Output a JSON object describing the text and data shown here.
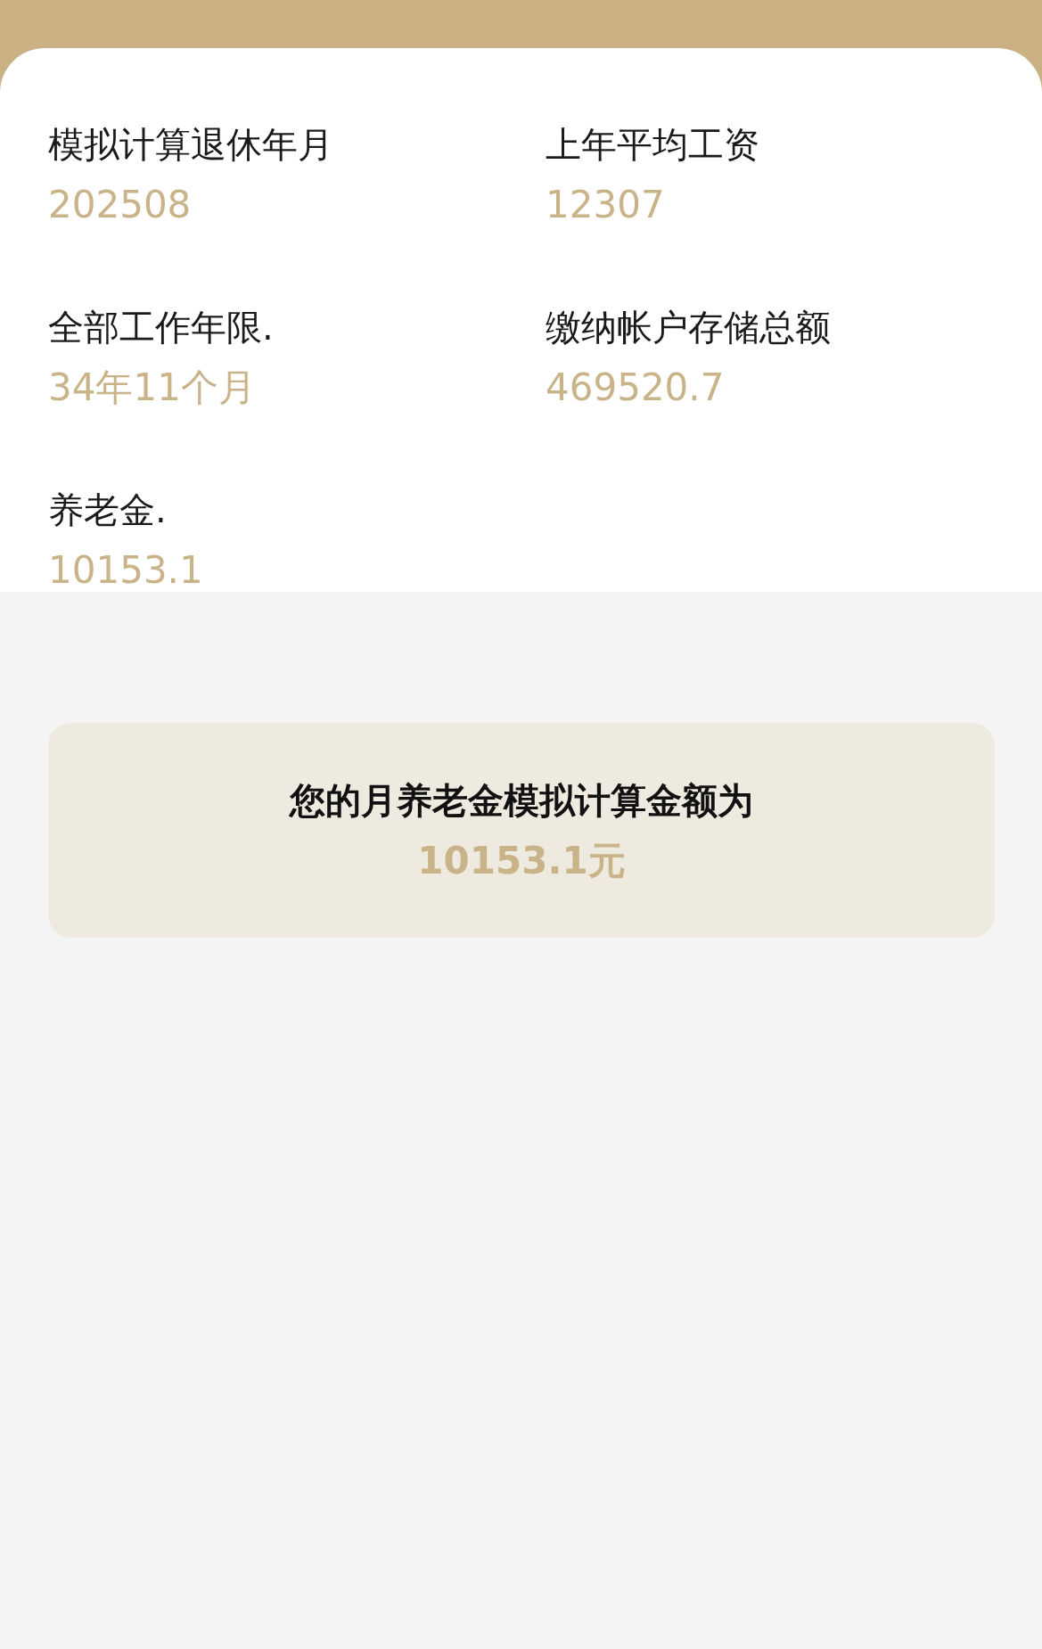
{
  "fields": [
    {
      "label": "模拟计算退休年月",
      "value": "202508"
    },
    {
      "label": "上年平均工资",
      "value": "12307"
    },
    {
      "label": "全部工作年限.",
      "value": "34年11个月"
    },
    {
      "label": "缴纳帐户存储总额",
      "value": "469520.7"
    },
    {
      "label": "养老金.",
      "value": "10153.1"
    }
  ],
  "result": {
    "title": "您的月养老金模拟计算金额为",
    "amount": "10153.1元"
  }
}
